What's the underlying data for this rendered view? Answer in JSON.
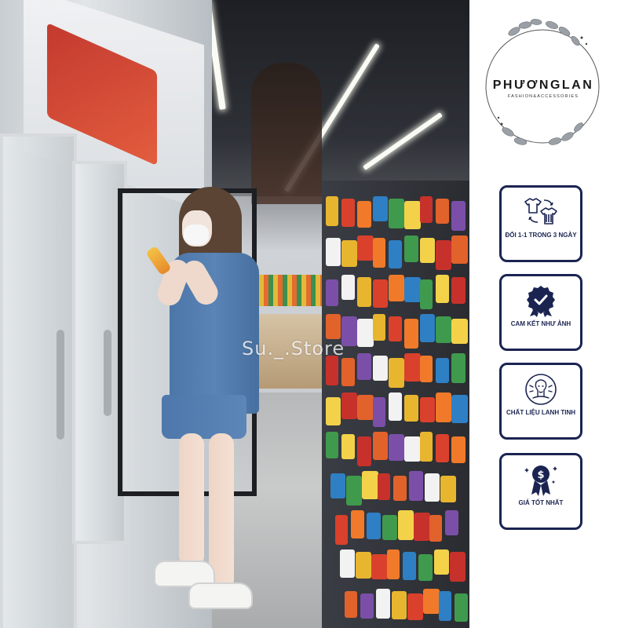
{
  "watermark": "Su._.Store",
  "brand": {
    "name": "PHƯƠNGLAN",
    "tagline": "FASHION&ACCESSORIES"
  },
  "features": [
    {
      "icon": "shirt-exchange-icon",
      "label": "ĐỔI 1-1 TRONG 3 NGÀY"
    },
    {
      "icon": "verified-badge-icon",
      "label": "CAM KẾT NHƯ ẢNH"
    },
    {
      "icon": "fabric-person-icon",
      "label": "CHẤT LIỆU LANH TINH"
    },
    {
      "icon": "price-medal-icon",
      "label": "GIÁ TỐT NHẤT"
    }
  ],
  "colors": {
    "card_border": "#1b2451",
    "shirt_blue": "#5a84b6",
    "text_dark": "#1a1a1a"
  }
}
